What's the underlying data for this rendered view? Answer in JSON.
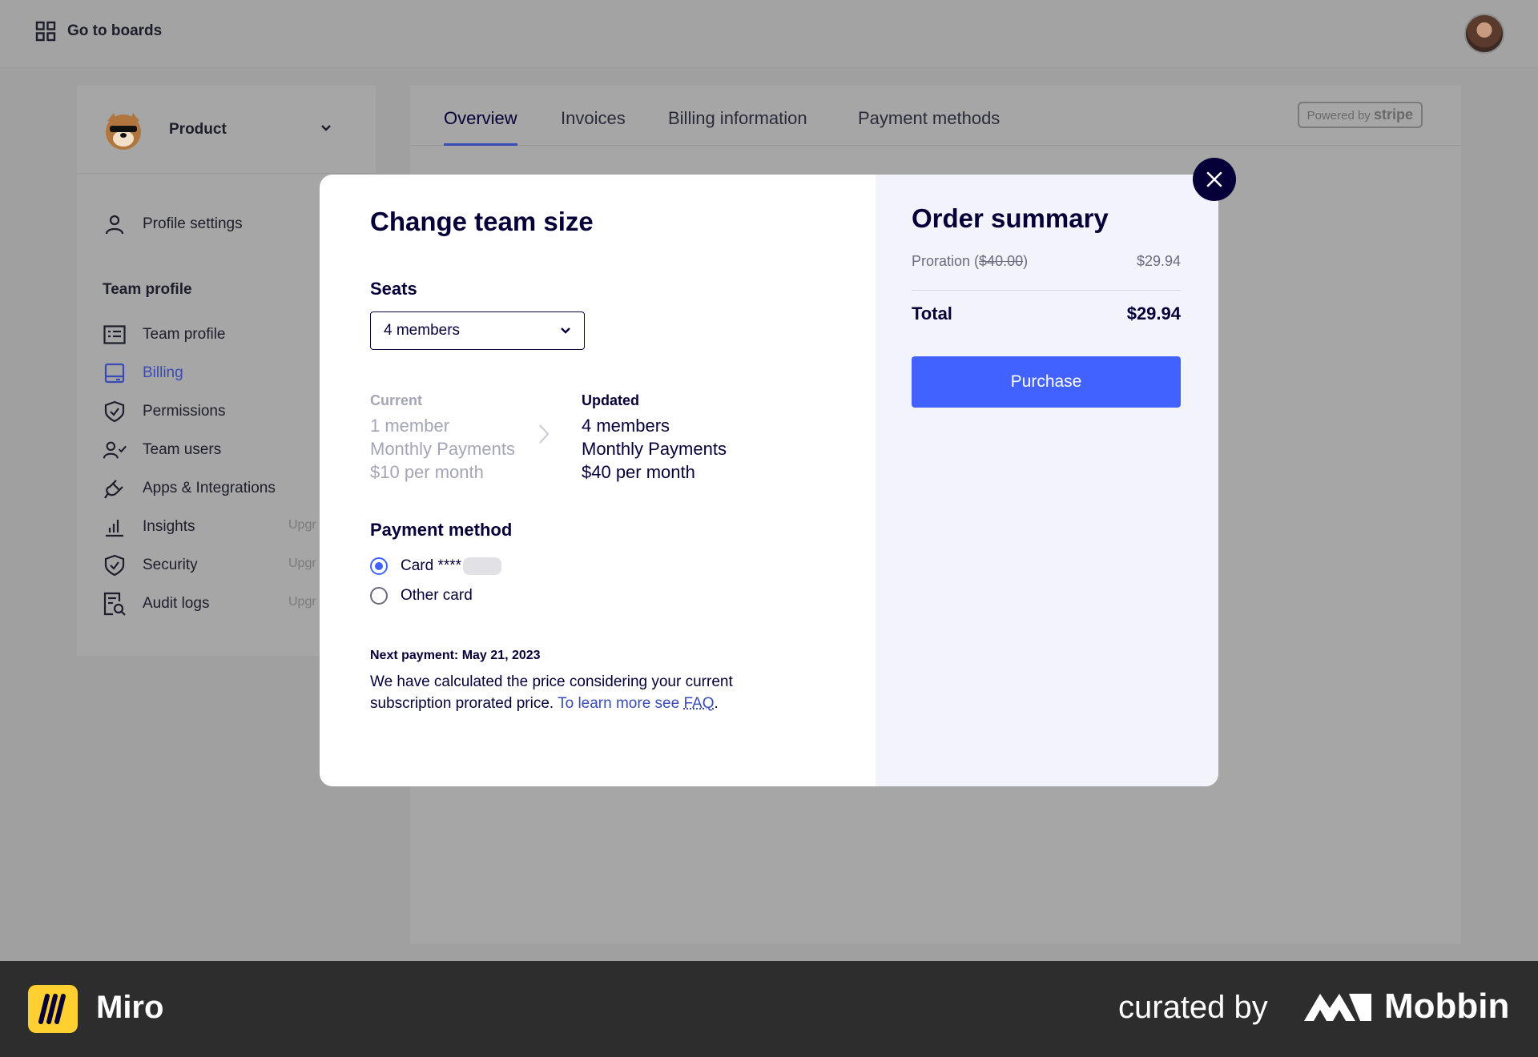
{
  "topbar": {
    "goto_label": "Go to boards"
  },
  "sidebar": {
    "team_name": "Product",
    "profile_settings": "Profile settings",
    "section_title": "Team profile",
    "items": [
      {
        "label": "Team profile",
        "icon": "team-profile-icon"
      },
      {
        "label": "Billing",
        "icon": "billing-icon",
        "active": true
      },
      {
        "label": "Permissions",
        "icon": "shield-icon"
      },
      {
        "label": "Team users",
        "icon": "team-users-icon"
      },
      {
        "label": "Apps & Integrations",
        "icon": "plug-icon"
      },
      {
        "label": "Insights",
        "icon": "chart-icon",
        "badge": "Upgr"
      },
      {
        "label": "Security",
        "icon": "shield-icon",
        "badge": "Upgr"
      },
      {
        "label": "Audit logs",
        "icon": "audit-icon",
        "badge": "Upgr"
      }
    ]
  },
  "tabs": [
    "Overview",
    "Invoices",
    "Billing information",
    "Payment methods"
  ],
  "stripe": {
    "prefix": "Powered by",
    "brand": "stripe"
  },
  "modal": {
    "title": "Change team size",
    "seats_label": "Seats",
    "seats_value": "4 members",
    "current": {
      "heading": "Current",
      "members": "1 member",
      "plan": "Monthly Payments",
      "price": "$10 per month"
    },
    "updated": {
      "heading": "Updated",
      "members": "4 members",
      "plan": "Monthly Payments",
      "price": "$40 per month"
    },
    "payment_label": "Payment method",
    "card_option": "Card ****",
    "other_card_option": "Other card",
    "next_payment": "Next payment: May 21, 2023",
    "note_text": "We have calculated the price considering your current subscription prorated price.",
    "note_link_prefix": "To learn more see",
    "note_link": "FAQ"
  },
  "order_summary": {
    "title": "Order summary",
    "proration_label": "Proration (",
    "proration_strike": "$40.00",
    "proration_close": ")",
    "proration_value": "$29.94",
    "total_label": "Total",
    "total_value": "$29.94",
    "purchase_label": "Purchase"
  },
  "footer": {
    "app_name": "Miro",
    "curated_by": "curated by",
    "brand": "Mobbin"
  },
  "colors": {
    "accent": "#4262ff",
    "navy": "#050038",
    "link": "#3a4bb7"
  }
}
